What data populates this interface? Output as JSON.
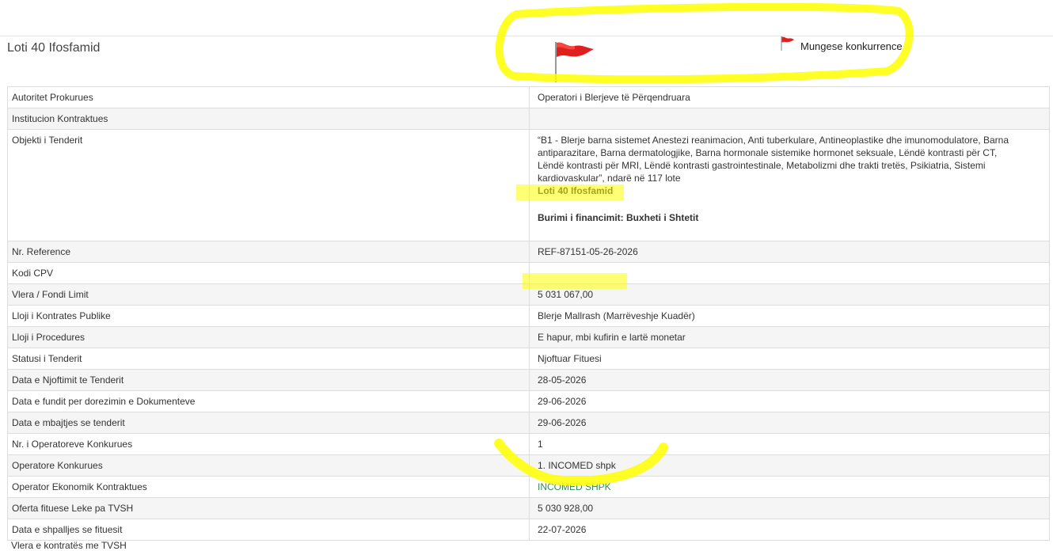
{
  "header": {
    "title": "Loti 40 Ifosfamid",
    "flag_label": "Mungese konkurrence"
  },
  "colors": {
    "flag_red": "#e02020",
    "highlighter": "#ffff00",
    "link_green": "#2e8b57"
  },
  "details": {
    "rows": [
      {
        "label": "Autoritet Prokurues",
        "value": "Operatori i Blerjeve të Përqendruara"
      },
      {
        "label": "Institucion Kontraktues",
        "value": ""
      },
      {
        "label": "Objekti i Tenderit",
        "description": "“B1 - Blerje barna sistemet Anestezi reanimacion, Anti tuberkulare, Antineoplastike dhe imunomodulatore, Barna antiparazitare, Barna dermatologjike, Barna hormonale sistemike hormonet seksuale, Lëndë kontrasti për CT, Lëndë kontrasti për MRI, Lëndë kontrasti gastrointestinale, Metabolizmi dhe trakti tretës, Psikiatria, Sistemi kardiovaskular”, ndarë në 117 lote",
        "lot": "Loti 40 Ifosfamid",
        "funding": "Burimi i financimit: Buxheti i Shtetit"
      },
      {
        "label": "Nr. Reference",
        "value": "REF-87151-05-26-2026"
      },
      {
        "label": "Kodi CPV",
        "value": ""
      },
      {
        "label": "Vlera / Fondi Limit",
        "value": "5 031 067,00"
      },
      {
        "label": "Lloji i Kontrates Publike",
        "value": "Blerje Mallrash (Marrëveshje Kuadër)"
      },
      {
        "label": "Lloji i Procedures",
        "value": "E hapur, mbi kufirin e lartë monetar"
      },
      {
        "label": "Statusi i Tenderit",
        "value": "Njoftuar Fituesi"
      },
      {
        "label": "Data e Njoftimit te Tenderit",
        "value": "28-05-2026"
      },
      {
        "label": "Data e fundit per dorezimin e Dokumenteve",
        "value": "29-06-2026"
      },
      {
        "label": "Data e mbajtjes se tenderit",
        "value": "29-06-2026"
      },
      {
        "label": "Nr. i Operatoreve Konkurues",
        "value": "1"
      },
      {
        "label": "Operatore Konkurues",
        "value": "1. INCOMED shpk"
      },
      {
        "label": "Operator Ekonomik Kontraktues",
        "value": "INCOMED SHPK"
      },
      {
        "label": "Oferta fituese Leke pa TVSH",
        "value": "5 030 928,00"
      },
      {
        "label": "Data e shpalljes se fituesit",
        "value": "22-07-2026"
      }
    ],
    "cut_off_label": "Vlera e kontratës me TVSH"
  }
}
